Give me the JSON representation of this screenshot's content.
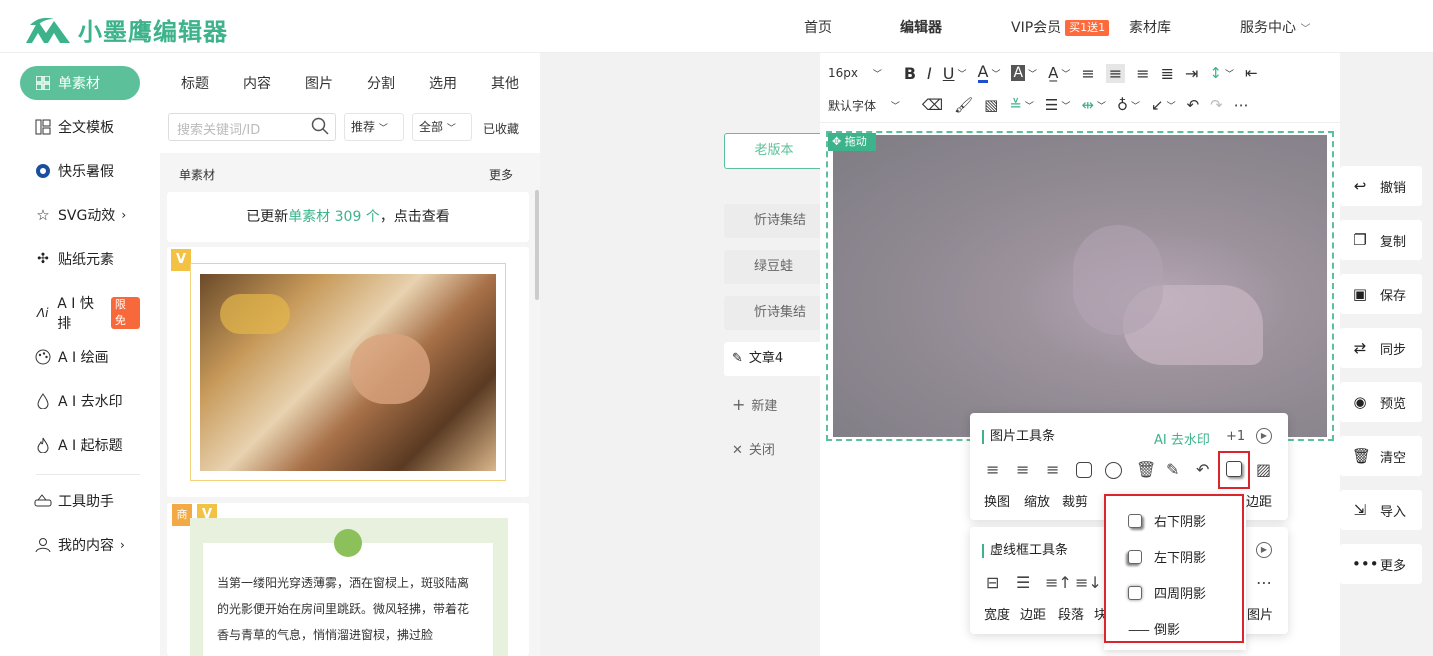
{
  "brand": {
    "name": "小墨鹰编辑器",
    "color": "#3cb38a"
  },
  "nav": {
    "home": "首页",
    "editor": "编辑器",
    "vip": "VIP会员",
    "vip_badge": "买1送1",
    "materials": "素材库",
    "service": "服务中心"
  },
  "sidebar": {
    "items": [
      {
        "label": "单素材",
        "icon": "grid-icon"
      },
      {
        "label": "全文模板",
        "icon": "layout-icon"
      },
      {
        "label": "快乐暑假",
        "icon": "ball-icon"
      },
      {
        "label": "SVG动效",
        "icon": "star-icon"
      },
      {
        "label": "贴纸元素",
        "icon": "puzzle-icon"
      },
      {
        "label": "A I 快排",
        "icon": "ai-icon",
        "badge": "限免"
      },
      {
        "label": "A I 绘画",
        "icon": "palette-icon"
      },
      {
        "label": "A I 去水印",
        "icon": "drop-icon"
      },
      {
        "label": "A I 起标题",
        "icon": "fire-icon"
      },
      {
        "label": "工具助手",
        "icon": "tool-icon"
      },
      {
        "label": "我的内容",
        "icon": "user-icon"
      }
    ]
  },
  "panel": {
    "tabs": [
      "标题",
      "内容",
      "图片",
      "分割",
      "选用",
      "其他"
    ],
    "search_placeholder": "搜索关键词/ID",
    "sort": "推荐",
    "filter": "全部",
    "favorites": "已收藏",
    "section_title": "单素材",
    "more": "更多",
    "update_pre": "已更新",
    "update_link": "单素材 309 个",
    "update_post": "，点击查看",
    "badge_business": "商",
    "card_text": "当第一缕阳光穿透薄雾，洒在窗棂上，斑驳陆离的光影便开始在房间里跳跃。微风轻拂，带着花香与青草的气息，悄悄溜进窗棂，拂过脸"
  },
  "versions": {
    "old": "老版本",
    "items": [
      "忻诗集结",
      "绿豆蛙",
      "忻诗集结"
    ],
    "article": "文章4",
    "new": "新建",
    "close": "关闭"
  },
  "toolbar": {
    "font_size": "16px",
    "font_family": "默认字体",
    "drag_label": "拖动"
  },
  "right_actions": [
    "撤销",
    "复制",
    "保存",
    "同步",
    "预览",
    "清空",
    "导入",
    "更多"
  ],
  "image_toolbar": {
    "title": "图片工具条",
    "ai_watermark": "AI 去水印",
    "plus": "+1",
    "labels": [
      "换图",
      "缩放",
      "裁剪",
      "边距"
    ]
  },
  "frame_toolbar": {
    "title": "虚线框工具条",
    "labels": [
      "宽度",
      "边距",
      "段落",
      "块",
      "图片"
    ]
  },
  "shadow_menu": [
    "右下阴影",
    "左下阴影",
    "四周阴影",
    "倒影"
  ]
}
